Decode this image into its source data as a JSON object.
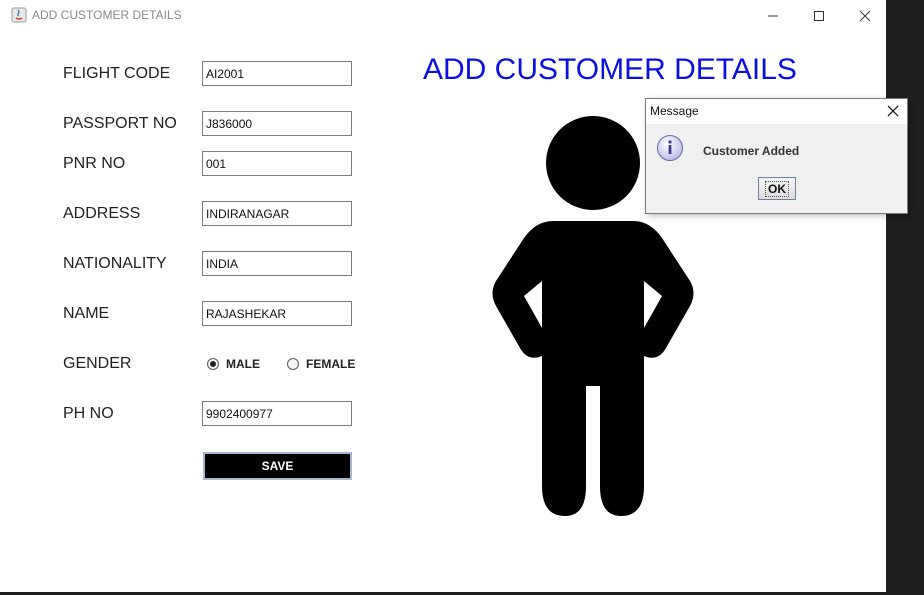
{
  "window": {
    "title": "ADD CUSTOMER DETAILS"
  },
  "form": {
    "heading": "ADD CUSTOMER DETAILS",
    "fields": [
      {
        "label": "FLIGHT CODE",
        "value": "AI2001"
      },
      {
        "label": "PASSPORT NO",
        "value": "J836000"
      },
      {
        "label": "PNR NO",
        "value": "001"
      },
      {
        "label": "ADDRESS",
        "value": "INDIRANAGAR"
      },
      {
        "label": "NATIONALITY",
        "value": "INDIA"
      },
      {
        "label": "NAME",
        "value": "RAJASHEKAR"
      },
      {
        "label": "PH NO",
        "value": "9902400977"
      }
    ],
    "gender": {
      "label": "GENDER",
      "options": [
        {
          "label": "MALE",
          "checked": true
        },
        {
          "label": "FEMALE",
          "checked": false
        }
      ]
    },
    "save_label": "SAVE"
  },
  "dialog": {
    "title": "Message",
    "message": "Customer Added",
    "ok_label": "OK",
    "icon": "info-icon"
  },
  "colors": {
    "heading": "#0a10e0",
    "save_button_bg": "#000000"
  }
}
